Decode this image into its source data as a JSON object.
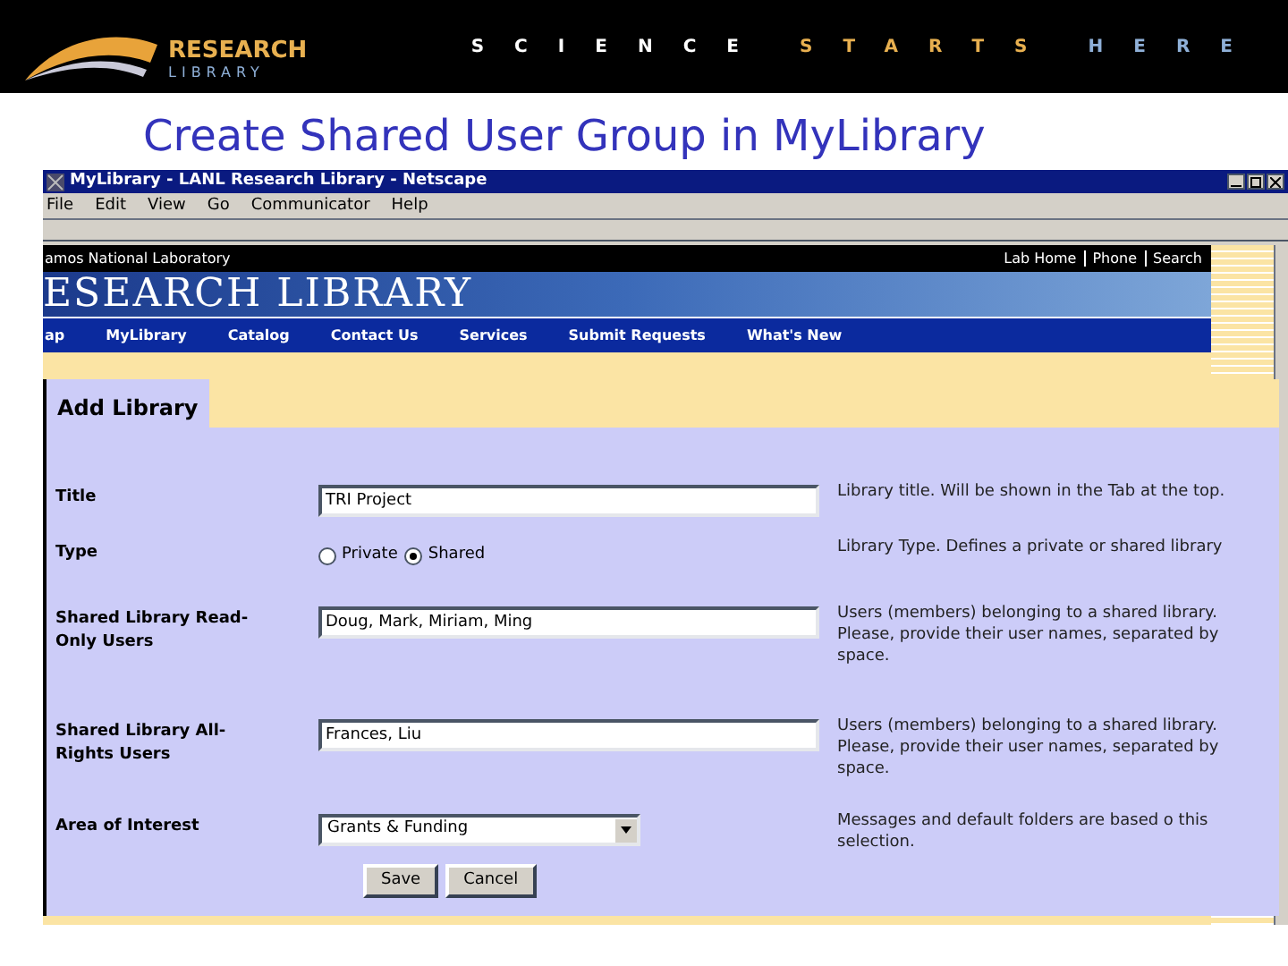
{
  "slide": {
    "logo_top": "RESEARCH",
    "logo_bottom": "LIBRARY",
    "tagline": [
      {
        "text": "SCIENCE",
        "color": "#ffffff"
      },
      {
        "text": "STARTS",
        "color": "#e8b050"
      },
      {
        "text": "HERE",
        "color": "#8fb0d8"
      }
    ],
    "title": "Create Shared User Group in MyLibrary"
  },
  "window": {
    "title": "MyLibrary - LANL Research Library - Netscape",
    "menu": [
      "File",
      "Edit",
      "View",
      "Go",
      "Communicator",
      "Help"
    ]
  },
  "site": {
    "org": "amos National Laboratory",
    "top_links": [
      "Lab Home",
      "Phone",
      "Search"
    ],
    "banner": "ESEARCH LIBRARY",
    "nav": [
      "ap",
      "MyLibrary",
      "Catalog",
      "Contact Us",
      "Services",
      "Submit Requests",
      "What's New"
    ]
  },
  "form": {
    "heading": "Add Library",
    "rows": [
      {
        "kind": "text",
        "label": "Title",
        "value": "TRI Project",
        "help": "Library title. Will be shown in the Tab at the top."
      },
      {
        "kind": "radio",
        "label": "Type",
        "options": [
          {
            "label": "Private",
            "selected": false
          },
          {
            "label": "Shared",
            "selected": true
          }
        ],
        "help": "Library Type. Defines a private or shared library"
      },
      {
        "kind": "text",
        "label": "Shared Library Read-Only Users",
        "value": "Doug, Mark, Miriam, Ming",
        "help": "Users (members) belonging to a shared library. Please, provide their user names, separated by space."
      },
      {
        "kind": "text",
        "label": "Shared Library All-Rights Users",
        "value": "Frances, Liu",
        "help": "Users (members) belonging to a shared library. Please, provide their user names, separated by space."
      },
      {
        "kind": "select",
        "label": "Area of Interest",
        "value": "Grants & Funding",
        "help": "Messages and default folders are based o this selection."
      }
    ],
    "buttons": [
      "Save",
      "Cancel"
    ]
  }
}
